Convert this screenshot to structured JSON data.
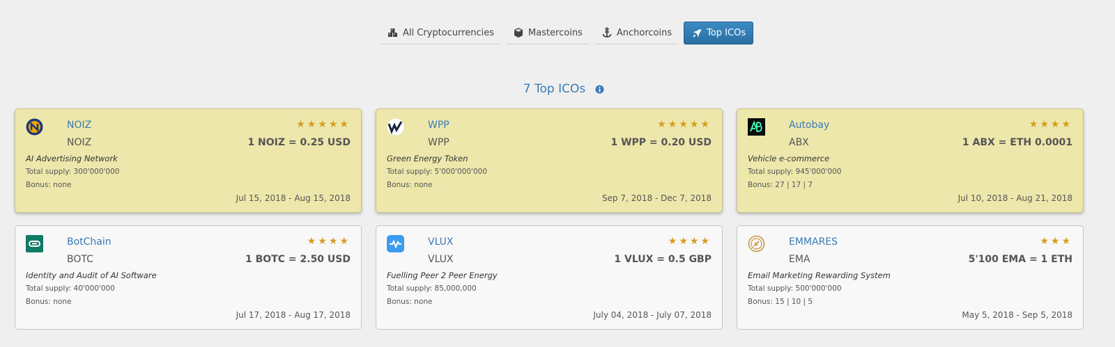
{
  "tabs": [
    {
      "label": "All Cryptocurrencies",
      "icon": "cubes-icon",
      "active": false
    },
    {
      "label": "Mastercoins",
      "icon": "cube-icon",
      "active": false
    },
    {
      "label": "Anchorcoins",
      "icon": "anchor-icon",
      "active": false
    },
    {
      "label": "Top ICOs",
      "icon": "rocket-icon",
      "active": true
    }
  ],
  "section_title": "7 Top ICOs",
  "stars_glyph": "★",
  "cards": [
    {
      "name": "NOIZ",
      "symbol": "NOIZ",
      "stars": 5,
      "stars_text": "★★★★★",
      "price": "1 NOIZ = 0.25 USD",
      "description": "AI Advertising Network",
      "supply": "Total supply: 300'000'000",
      "bonus": "Bonus: none",
      "dates": "Jul 15, 2018 - Aug 15, 2018",
      "featured": true,
      "logo": "noiz-logo-icon"
    },
    {
      "name": "WPP",
      "symbol": "WPP",
      "stars": 5,
      "stars_text": "★★★★★",
      "price": "1 WPP = 0.20 USD",
      "description": "Green Energy Token",
      "supply": "Total supply: 5'000'000'000",
      "bonus": "Bonus: none",
      "dates": "Sep 7, 2018 - Dec 7, 2018",
      "featured": true,
      "logo": "wpp-logo-icon"
    },
    {
      "name": "Autobay",
      "symbol": "ABX",
      "stars": 4,
      "stars_text": "★★★★",
      "price": "1 ABX = ETH 0.0001",
      "description": "Vehicle e-commerce",
      "supply": "Total supply: 945'000'000",
      "bonus": "Bonus: 27 | 17 | 7",
      "dates": "Jul 10, 2018 - Aug 21, 2018",
      "featured": true,
      "logo": "autobay-logo-icon"
    },
    {
      "name": "BotChain",
      "symbol": "BOTC",
      "stars": 4,
      "stars_text": "★★★★",
      "price": "1 BOTC = 2.50 USD",
      "description": "Identity and Audit of AI Software",
      "supply": "Total supply: 40'000'000",
      "bonus": "Bonus: none",
      "dates": "Jul 17, 2018 - Aug 17, 2018",
      "featured": false,
      "logo": "botchain-logo-icon"
    },
    {
      "name": "VLUX",
      "symbol": "VLUX",
      "stars": 4,
      "stars_text": "★★★★",
      "price": "1 VLUX = 0.5 GBP",
      "description": "Fuelling Peer 2 Peer Energy",
      "supply": "Total supply: 85,000,000",
      "bonus": "Bonus: none",
      "dates": "July 04, 2018 - July 07, 2018",
      "featured": false,
      "logo": "vlux-logo-icon"
    },
    {
      "name": "EMMARES",
      "symbol": "EMA",
      "stars": 3,
      "stars_text": "★★★",
      "price": "5'100 EMA = 1 ETH",
      "description": "Email Marketing Rewarding System",
      "supply": "Total supply: 500'000'000",
      "bonus": "Bonus: 15 | 10 | 5",
      "dates": "May 5, 2018 - Sep 5, 2018",
      "featured": false,
      "logo": "emmares-logo-icon"
    }
  ]
}
